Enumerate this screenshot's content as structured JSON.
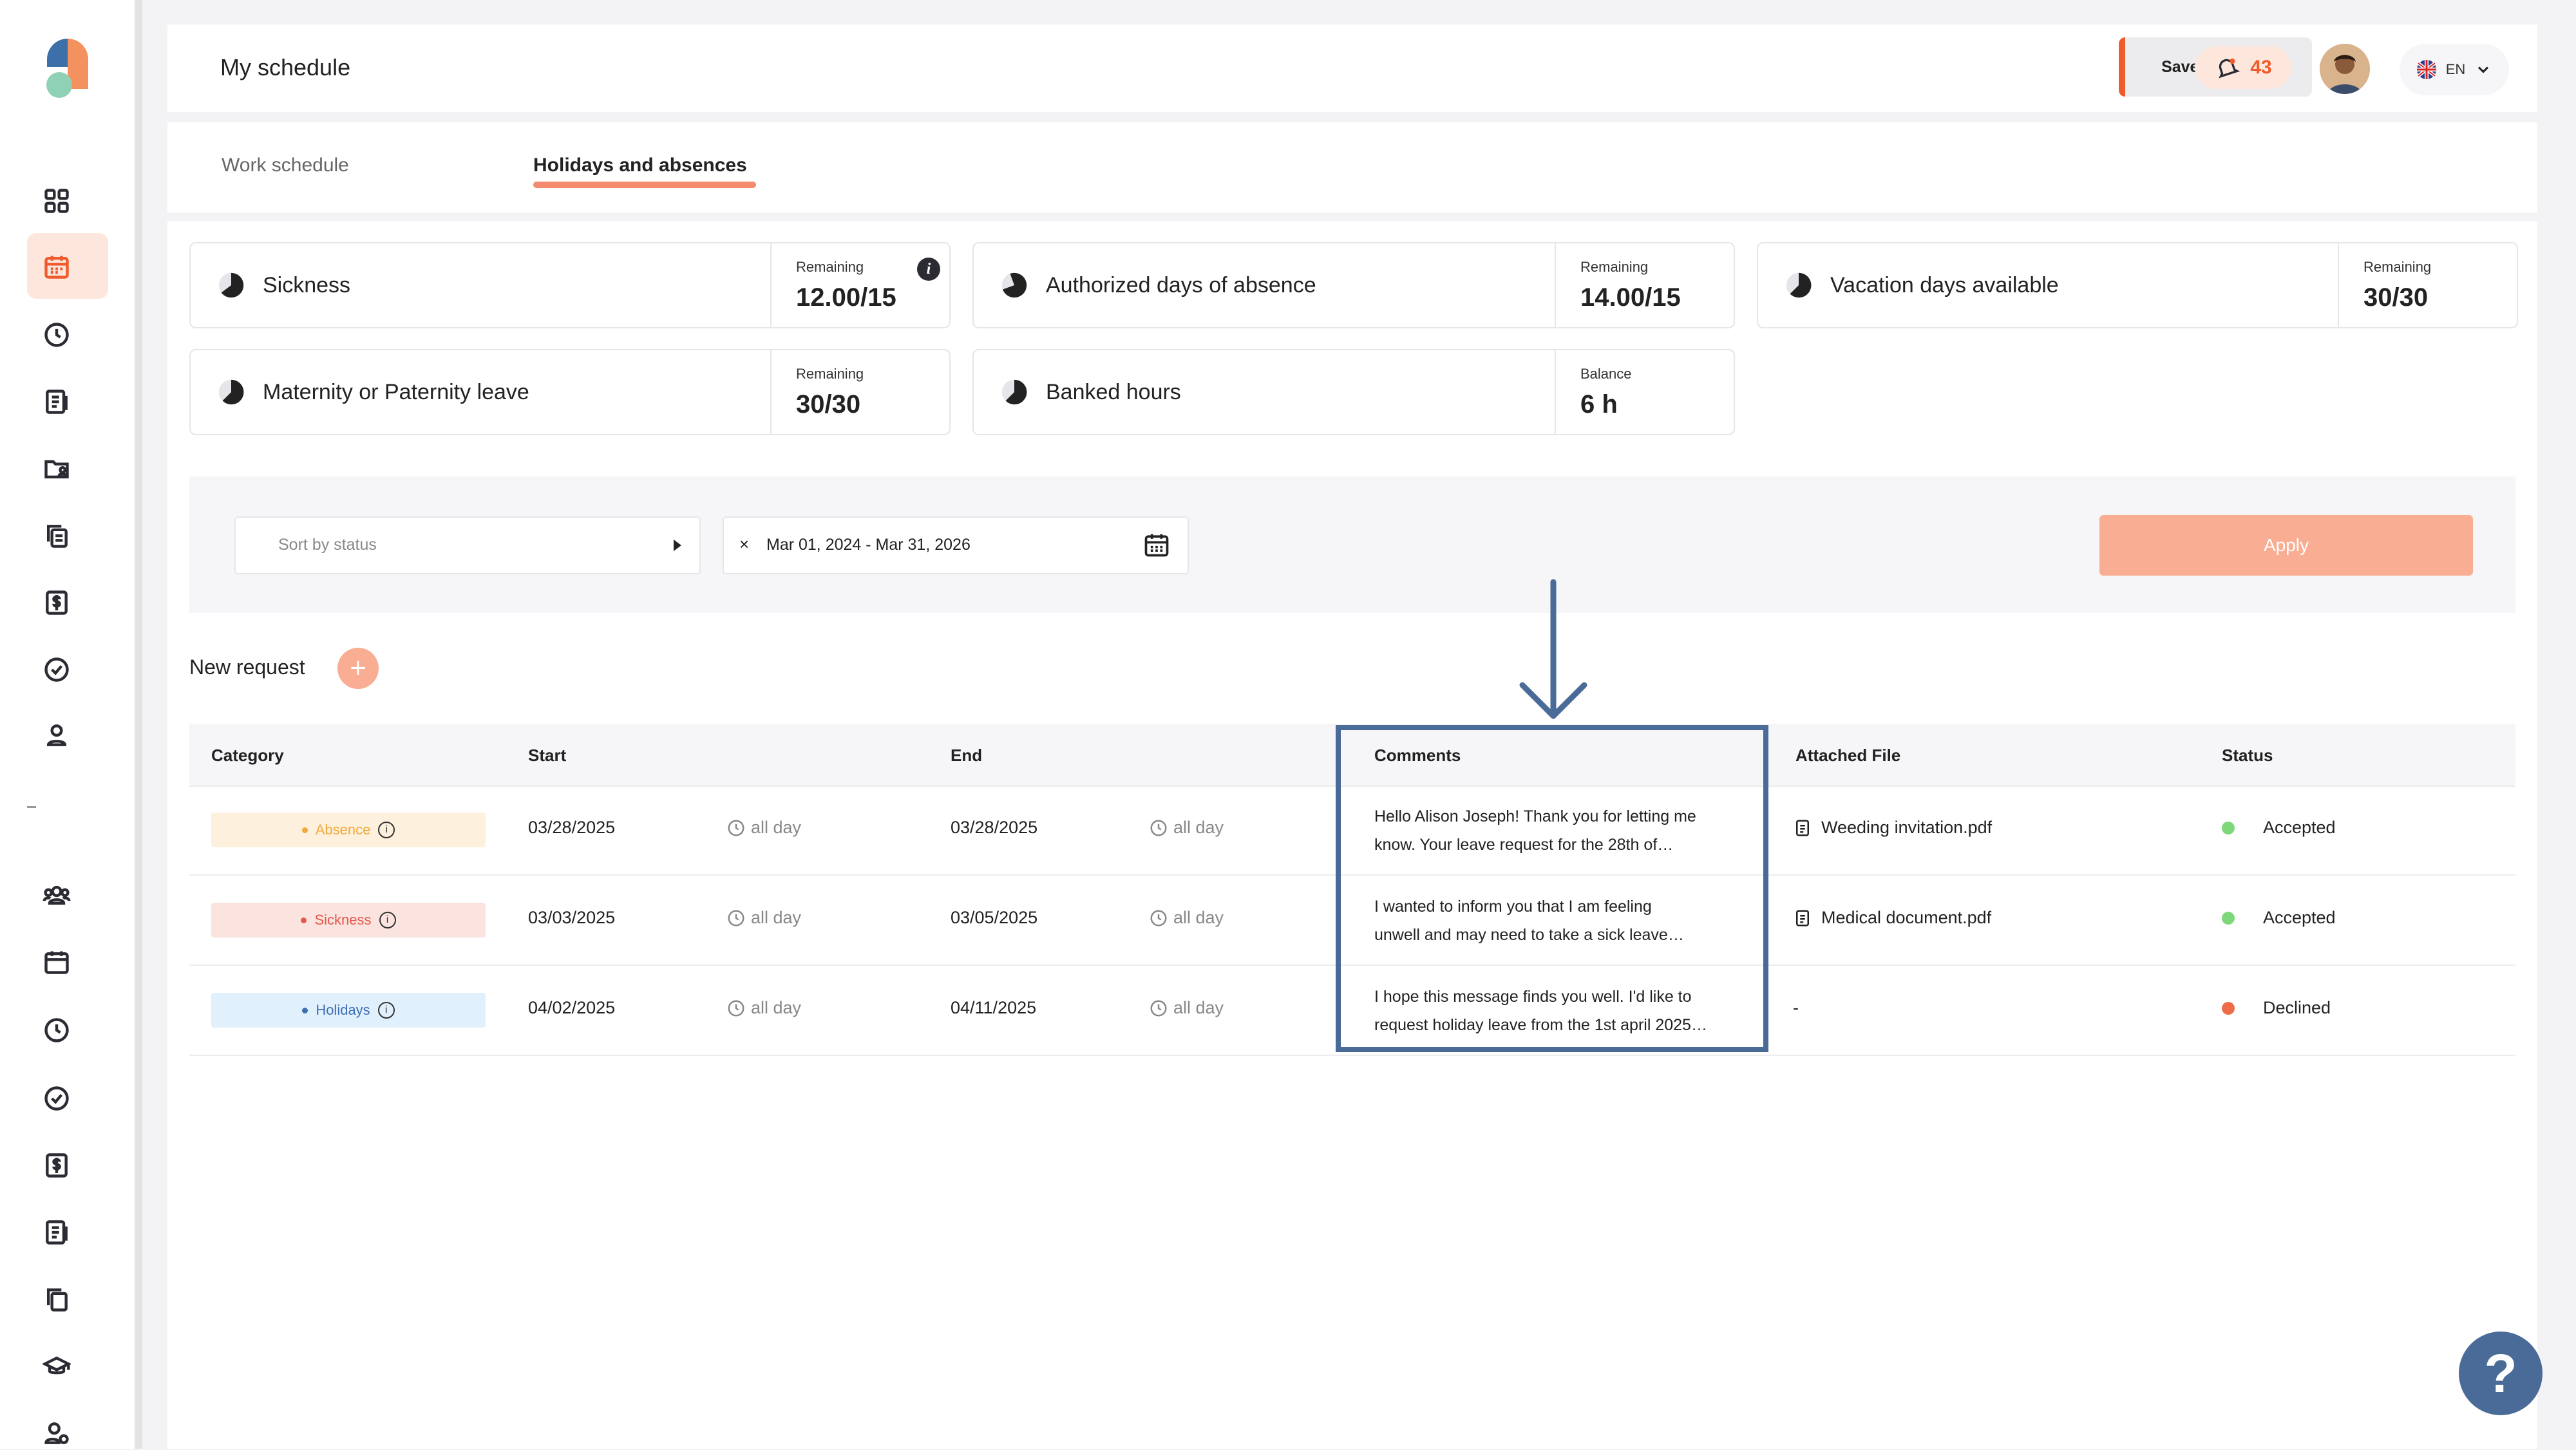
{
  "header": {
    "title": "My schedule",
    "save_label": "Save my hours",
    "notifications_count": "43",
    "language": "EN"
  },
  "tabs": [
    {
      "label": "Work schedule",
      "active": false
    },
    {
      "label": "Holidays and absences",
      "active": true
    }
  ],
  "balances": [
    {
      "title": "Sickness",
      "label": "Remaining",
      "value": "12.00/15",
      "has_info": true
    },
    {
      "title": "Authorized days of absence",
      "label": "Remaining",
      "value": "14.00/15"
    },
    {
      "title": "Vacation days available",
      "label": "Remaining",
      "value": "30/30"
    },
    {
      "title": "Maternity or Paternity leave",
      "label": "Remaining",
      "value": "30/30"
    },
    {
      "title": "Banked hours",
      "label": "Balance",
      "value": "6 h"
    }
  ],
  "filters": {
    "sort_placeholder": "Sort by status",
    "clear_symbol": "×",
    "date_range": "Mar 01, 2024 - Mar 31, 2026",
    "apply_label": "Apply"
  },
  "new_request": {
    "label": "New request",
    "plus": "+"
  },
  "table": {
    "headers": [
      "Category",
      "Start",
      "End",
      "Comments",
      "Attached File",
      "Status"
    ],
    "rows": [
      {
        "category": "Absence",
        "category_color": "#f2a93b",
        "category_bg": "#fdf0dc",
        "start": "03/28/2025",
        "start_time": "all day",
        "end": "03/28/2025",
        "end_time": "all day",
        "comment_1": "Hello Alison Joseph! Thank you for letting me",
        "comment_2": "know. Your leave request for the 28th of…",
        "file": "Weeding invitation.pdf",
        "status": "Accepted",
        "status_color": "#7ed87a"
      },
      {
        "category": "Sickness",
        "category_color": "#e4574a",
        "category_bg": "#fbe4df",
        "start": "03/03/2025",
        "start_time": "all day",
        "end": "03/05/2025",
        "end_time": "all day",
        "comment_1": "I wanted to inform you that I am feeling",
        "comment_2": "unwell and may need to take a sick leave…",
        "file": "Medical document.pdf",
        "status": "Accepted",
        "status_color": "#7ed87a"
      },
      {
        "category": "Holidays",
        "category_color": "#3d6fb4",
        "category_bg": "#e1f0fd",
        "start": "04/02/2025",
        "start_time": "all day",
        "end": "04/11/2025",
        "end_time": "all day",
        "comment_1": "I hope this message finds you well. I'd like to",
        "comment_2": "request holiday leave from the 1st april 2025…",
        "file": "-",
        "status": "Declined",
        "status_color": "#ef6c4a"
      }
    ]
  },
  "help": {
    "label": "?"
  },
  "colors": {
    "accent": "#ef5b2c",
    "accent_light": "#f9ad92",
    "annotation": "#4a6b97"
  }
}
